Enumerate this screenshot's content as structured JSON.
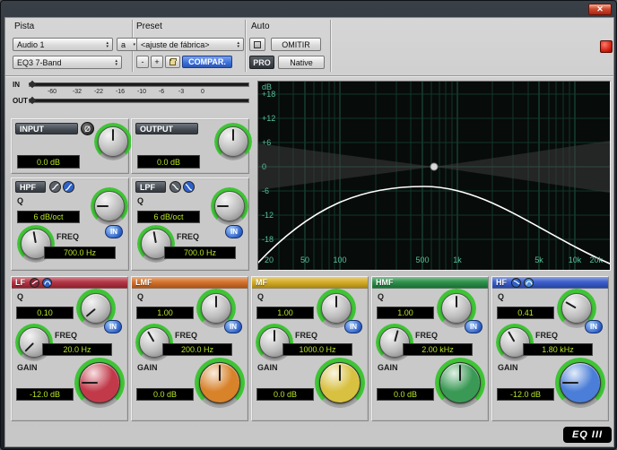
{
  "window": {
    "title": ""
  },
  "icons": {
    "up": "▴",
    "down": "▾",
    "phase": "Ø",
    "close": "✕"
  },
  "header": {
    "track_section_label": "Pista",
    "preset_section_label": "Preset",
    "auto_section_label": "Auto",
    "track_selector": "Audio 1",
    "track_letter": "a",
    "plugin_selector": "EQ3 7-Band",
    "preset_selector": "<ajuste de fábrica>",
    "minus_label": "-",
    "plus_label": "+",
    "compare_label": "COMPAR.",
    "bypass_label": "OMITIR",
    "pro_label": "PRO",
    "native_label": "Native"
  },
  "meters": {
    "in_label": "IN",
    "out_label": "OUT",
    "scale": [
      "-60",
      "-32",
      "-22",
      "-16",
      "-10",
      "-6",
      "-3",
      "0"
    ]
  },
  "io": {
    "input_label": "INPUT",
    "input_value": "0.0 dB",
    "output_label": "OUTPUT",
    "output_value": "0.0 dB"
  },
  "filters": {
    "q_label": "Q",
    "freq_label": "FREQ",
    "in_label": "IN",
    "hpf": {
      "label": "HPF",
      "slope": "6 dB/oct",
      "freq": "700.0 Hz"
    },
    "lpf": {
      "label": "LPF",
      "slope": "6 dB/oct",
      "freq": "700.0 Hz"
    }
  },
  "graph": {
    "unit_label": "dB",
    "db_labels": [
      "+18",
      "+12",
      "+6",
      "0",
      "-6",
      "-12",
      "-18"
    ],
    "freq_labels": [
      "20",
      "50",
      "100",
      "500",
      "1k",
      "5k",
      "10k",
      "20k"
    ],
    "grid_color": "#1d5a44",
    "curve_color": "#ffffff",
    "background": "#070b09"
  },
  "band_labels": {
    "q": "Q",
    "freq": "FREQ",
    "gain": "GAIN",
    "in": "IN"
  },
  "bands": [
    {
      "label": "LF",
      "q": "0.10",
      "freq": "20.0 Hz",
      "gain": "-12.0 dB",
      "color": "#c23a4a",
      "header_color": "#b02838"
    },
    {
      "label": "LMF",
      "q": "1.00",
      "freq": "200.0 Hz",
      "gain": "0.0 dB",
      "color": "#d8822a",
      "header_color": "#d2691e"
    },
    {
      "label": "MF",
      "q": "1.00",
      "freq": "1000.0 Hz",
      "gain": "0.0 dB",
      "color": "#d8c040",
      "header_color": "#d2a818"
    },
    {
      "label": "HMF",
      "q": "1.00",
      "freq": "2.00 kHz",
      "gain": "0.0 dB",
      "color": "#3a9a55",
      "header_color": "#1f8a3f"
    },
    {
      "label": "HF",
      "q": "0.41",
      "freq": "1.80 kHz",
      "gain": "-12.0 dB",
      "color": "#4a7ed8",
      "header_color": "#2f54c8"
    }
  ],
  "logo": "EQ III",
  "accent": {
    "lcd_text": "#b8e625",
    "in_button": "#2f62c8",
    "compare_bg": "#3a6fd8"
  }
}
